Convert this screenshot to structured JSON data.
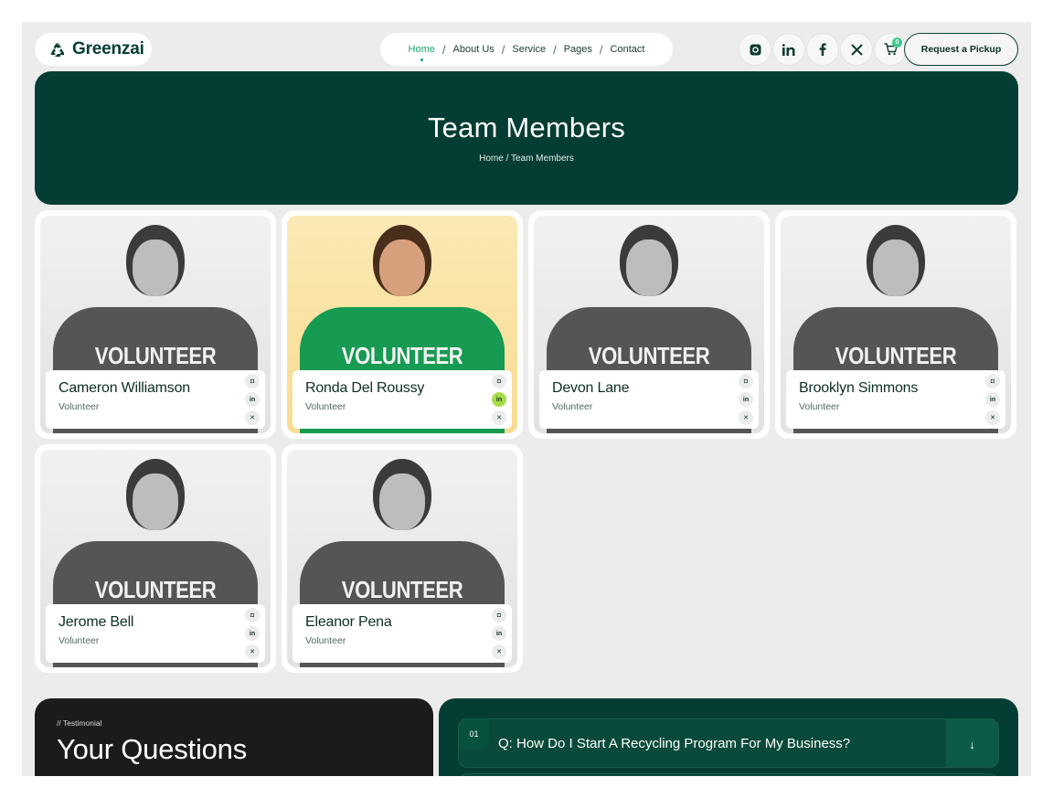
{
  "header": {
    "logo_text": "Greenzai",
    "nav": [
      {
        "label": "Home",
        "active": true
      },
      {
        "label": "About Us",
        "active": false
      },
      {
        "label": "Service",
        "active": false
      },
      {
        "label": "Pages",
        "active": false
      },
      {
        "label": "Contact",
        "active": false
      }
    ],
    "nav_separator": "/",
    "social_icons": [
      "instagram-icon",
      "linkedin-icon",
      "facebook-icon",
      "x-icon"
    ],
    "cart_count": "0",
    "cta_label": "Request a Pickup"
  },
  "hero": {
    "title": "Team Members",
    "breadcrumb": "Home / Team Members"
  },
  "team": {
    "shirt_text": "VOLUNTEER",
    "members": [
      {
        "name": "Cameron Williamson",
        "role": "Volunteer"
      },
      {
        "name": "Ronda Del Roussy",
        "role": "Volunteer"
      },
      {
        "name": "Devon Lane",
        "role": "Volunteer"
      },
      {
        "name": "Brooklyn Simmons",
        "role": "Volunteer"
      },
      {
        "name": "Jerome Bell",
        "role": "Volunteer"
      },
      {
        "name": "Eleanor Pena",
        "role": "Volunteer"
      }
    ]
  },
  "testimonial": {
    "tag": "// Testimonial",
    "heading": "Your Questions"
  },
  "faq": {
    "items": [
      {
        "num": "01",
        "question": "Q: How Do I Start A Recycling Program For My Business?"
      }
    ]
  },
  "colors": {
    "primary": "#043d33",
    "accent": "#1aa56b",
    "highlight": "#a6dd47"
  }
}
